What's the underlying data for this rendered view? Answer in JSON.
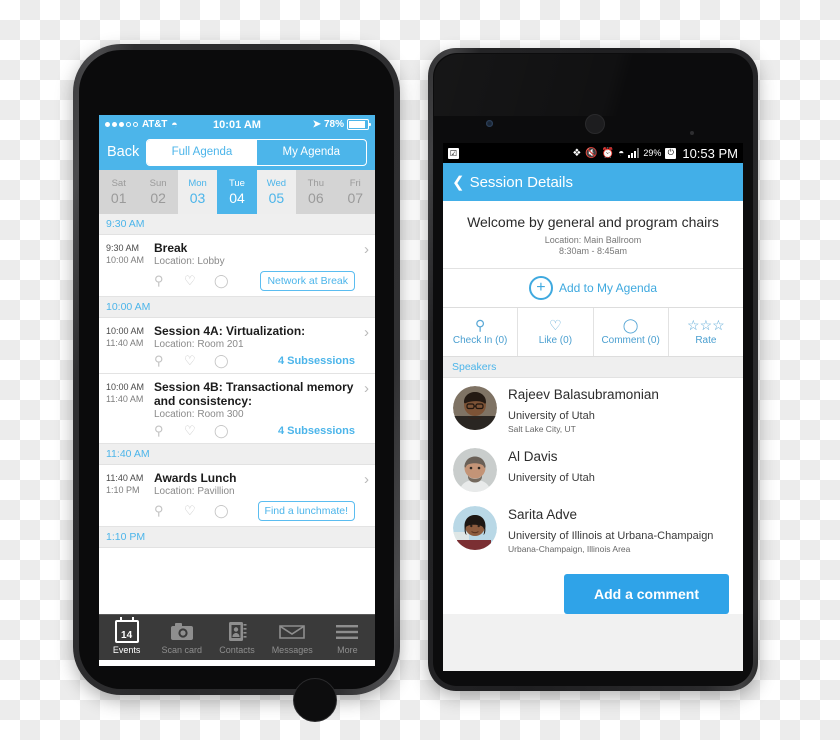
{
  "iphone": {
    "status": {
      "carrier": "AT&T",
      "clock": "10:01 AM",
      "battery": "78%",
      "wifi_icon": "wifi-icon",
      "location_icon": "location-arrow-icon"
    },
    "nav": {
      "back_label": "Back",
      "segments": [
        {
          "label": "Full Agenda",
          "active": true
        },
        {
          "label": "My Agenda",
          "active": false
        }
      ]
    },
    "days": [
      {
        "dow": "Sat",
        "num": "01",
        "state": "dim"
      },
      {
        "dow": "Sun",
        "num": "02",
        "state": "dim"
      },
      {
        "dow": "Mon",
        "num": "03",
        "state": "light"
      },
      {
        "dow": "Tue",
        "num": "04",
        "state": "selected"
      },
      {
        "dow": "Wed",
        "num": "05",
        "state": "light"
      },
      {
        "dow": "Thu",
        "num": "06",
        "state": "dim"
      },
      {
        "dow": "Fri",
        "num": "07",
        "state": "dim"
      }
    ],
    "groups": [
      {
        "header": "9:30 AM",
        "events": [
          {
            "start": "9:30 AM",
            "end": "10:00 AM",
            "title": "Break",
            "location": "Location: Lobby",
            "cta": "Network at Break",
            "subsessions": null
          }
        ]
      },
      {
        "header": "10:00 AM",
        "events": [
          {
            "start": "10:00 AM",
            "end": "11:40 AM",
            "title": "Session 4A: Virtualization:",
            "location": "Location: Room 201",
            "cta": null,
            "subsessions": "4 Subsessions"
          },
          {
            "start": "10:00 AM",
            "end": "11:40 AM",
            "title": "Session 4B: Transactional memory and consistency:",
            "location": "Location: Room 300",
            "cta": null,
            "subsessions": "4 Subsessions"
          }
        ]
      },
      {
        "header": "11:40 AM",
        "events": [
          {
            "start": "11:40 AM",
            "end": "1:10 PM",
            "title": "Awards Lunch",
            "location": "Location: Pavillion",
            "cta": "Find a lunchmate!",
            "subsessions": null
          }
        ]
      },
      {
        "header": "1:10 PM",
        "events": []
      }
    ],
    "tabs": [
      {
        "label": "Events",
        "icon": "calendar-icon",
        "badge": "14",
        "active": true
      },
      {
        "label": "Scan card",
        "icon": "camera-icon",
        "active": false
      },
      {
        "label": "Contacts",
        "icon": "contacts-book-icon",
        "active": false
      },
      {
        "label": "Messages",
        "icon": "envelope-icon",
        "active": false
      },
      {
        "label": "More",
        "icon": "hamburger-icon",
        "active": false
      }
    ]
  },
  "android": {
    "status": {
      "app_icon": "clipboard-icon",
      "icons": [
        "bluetooth-icon",
        "mute-icon",
        "alarm-icon",
        "wifi-icon",
        "signal-icon"
      ],
      "battery_pct": "29%",
      "clock": "10:53 PM"
    },
    "nav": {
      "back_icon": "chevron-left-icon",
      "title": "Session Details"
    },
    "session": {
      "title": "Welcome by general and program chairs",
      "location": "Location: Main Ballroom",
      "time": "8:30am - 8:45am"
    },
    "add_agenda": {
      "icon": "plus-circle-icon",
      "label": "Add to My Agenda"
    },
    "actions": [
      {
        "icon": "location-pin-icon",
        "label": "Check In (0)"
      },
      {
        "icon": "heart-icon",
        "label": "Like (0)"
      },
      {
        "icon": "comment-bubble-icon",
        "label": "Comment (0)"
      },
      {
        "icon": "stars-icon",
        "label": "Rate"
      }
    ],
    "speakers_header": "Speakers",
    "speakers": [
      {
        "name": "Rajeev Balasubramonian",
        "org": "University of Utah",
        "city": "Salt Lake City, UT",
        "avatar": "photo-avatar-1"
      },
      {
        "name": "Al Davis",
        "org": "University of Utah",
        "city": "",
        "avatar": "photo-avatar-2"
      },
      {
        "name": "Sarita Adve",
        "org": "University of Illinois at Urbana-Champaign",
        "city": "Urbana-Champaign, Illinois Area",
        "avatar": "photo-avatar-3"
      }
    ],
    "comment_button": "Add a comment"
  },
  "colors": {
    "ios_header_blue": "#4CB5EA",
    "android_header_blue": "#42AFE8",
    "accent_blue": "#3FA9DF",
    "comment_button_blue": "#2FA3E8",
    "tabbar_dark": "#3A3A3A"
  }
}
